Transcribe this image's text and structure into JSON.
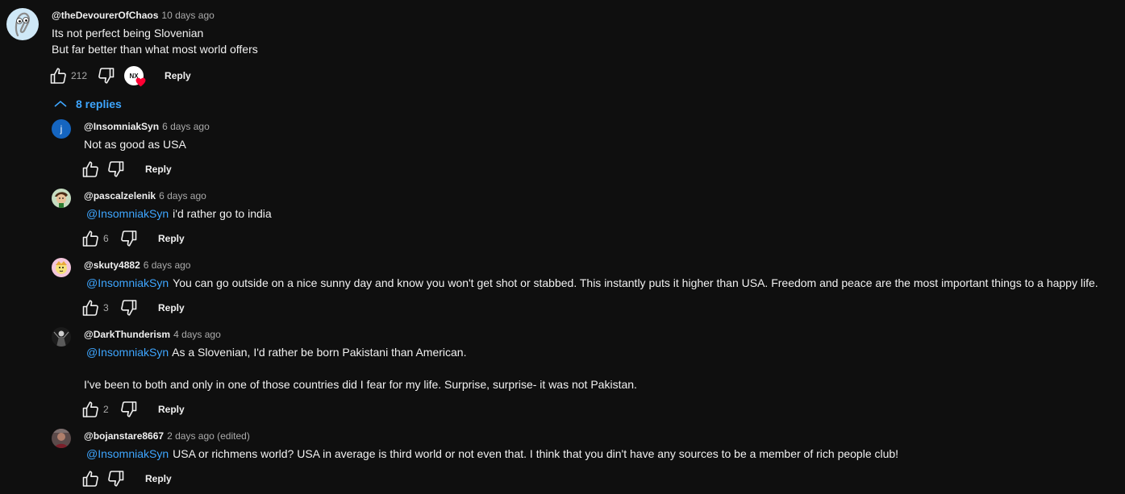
{
  "top_comment": {
    "author": "@theDevourerOfChaos",
    "time": "10 days ago",
    "lines": [
      "Its not perfect being Slovenian",
      "But far better than what most world offers"
    ],
    "likes": "212",
    "creator_heart_badge": "NX",
    "reply_label": "Reply",
    "replies_toggle": "8 replies"
  },
  "replies": [
    {
      "author": "@InsomniakSyn",
      "time": "6 days ago",
      "mention": "",
      "text": "Not as good as USA",
      "text2": "",
      "likes": "",
      "reply_label": "Reply",
      "avatar_letter": "j"
    },
    {
      "author": "@pascalzelenik",
      "time": "6 days ago",
      "mention": "@InsomniakSyn",
      "text": "i'd rather go to india",
      "text2": "",
      "likes": "6",
      "reply_label": "Reply"
    },
    {
      "author": "@skuty4882",
      "time": "6 days ago",
      "mention": "@InsomniakSyn",
      "text": "You can go outside on a nice sunny day and know you won't get shot or stabbed. This instantly puts it higher than USA. Freedom and peace are the most important things to a happy life.",
      "text2": "",
      "likes": "3",
      "reply_label": "Reply"
    },
    {
      "author": "@DarkThunderism",
      "time": "4 days ago",
      "mention": "@InsomniakSyn",
      "text": "As a Slovenian, I'd rather be born Pakistani than American.",
      "text2": "I've been to both and only in one of those countries did I fear for my life. Surprise, surprise- it was not Pakistan.",
      "likes": "2",
      "reply_label": "Reply"
    },
    {
      "author": "@bojanstare8667",
      "time": "2 days ago (edited)",
      "mention": "@InsomniakSyn",
      "text": "USA or richmens world? USA in average is third world or not even that. I think that you din't have any sources to be a member of rich people club!",
      "text2": "",
      "likes": "",
      "reply_label": "Reply"
    }
  ],
  "colors": {
    "background": "#0f0f0f",
    "text": "#f1f1f1",
    "secondary_text": "#aaaaaa",
    "link": "#3ea6ff",
    "heart": "#ff0033"
  },
  "icons": {
    "like": "thumbs-up-icon",
    "dislike": "thumbs-down-icon",
    "collapse": "chevron-up-icon",
    "heart": "heart-icon"
  }
}
